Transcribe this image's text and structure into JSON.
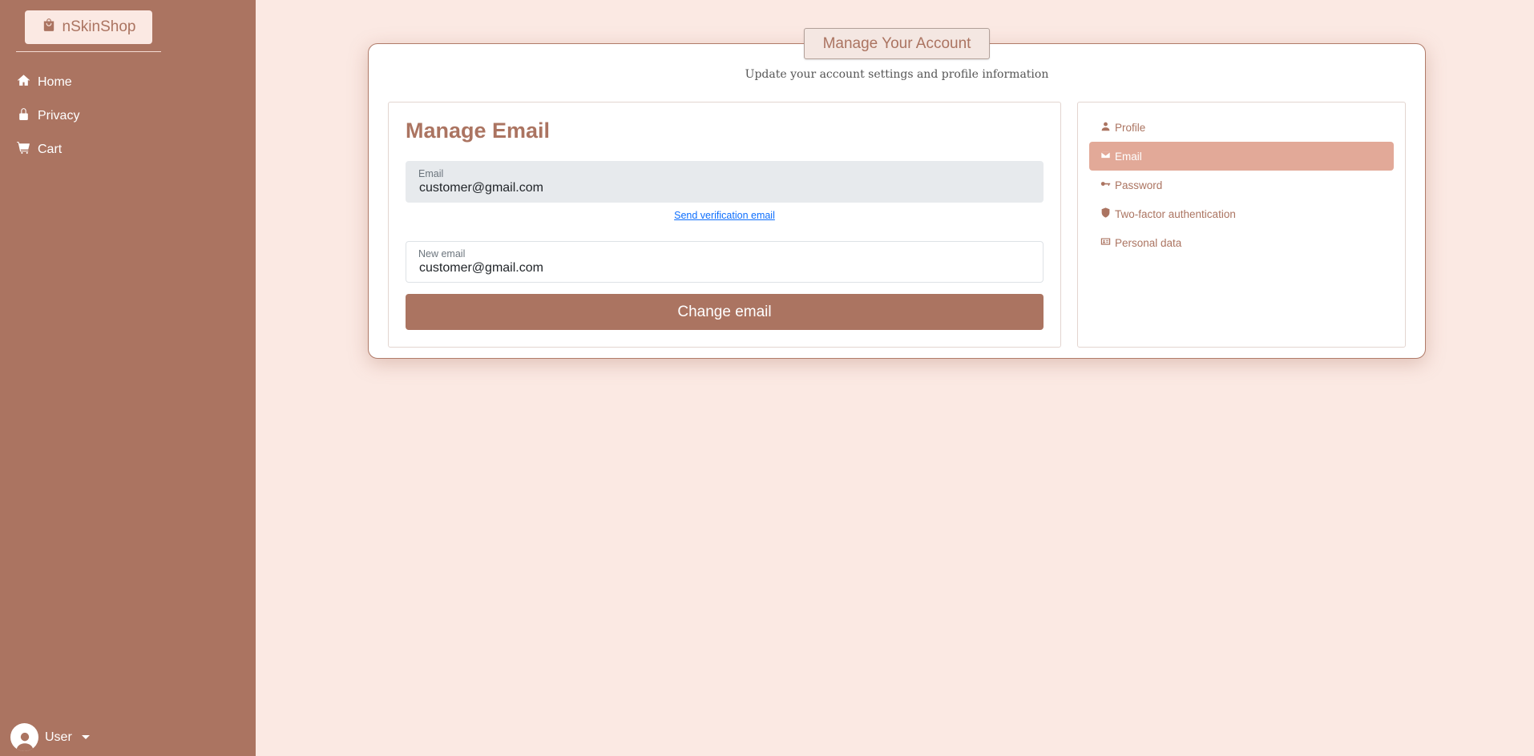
{
  "colors": {
    "sidebar": "#ab7461",
    "background": "#fbe9e3",
    "accent": "#ab7461",
    "active_nav": "#e2a998",
    "link": "#0d6efd"
  },
  "sidebar": {
    "brand": {
      "label": "nSkinShop",
      "icon": "shopping-bag-icon"
    },
    "items": [
      {
        "label": "Home",
        "icon": "home-icon"
      },
      {
        "label": "Privacy",
        "icon": "lock-icon"
      },
      {
        "label": "Cart",
        "icon": "cart-icon"
      }
    ],
    "user": {
      "label": "User",
      "icon": "user-avatar-icon"
    }
  },
  "card": {
    "title": "Manage Your Account",
    "subtitle": "Update your account settings and profile information"
  },
  "email_panel": {
    "title": "Manage Email",
    "email": {
      "label": "Email",
      "value": "customer@gmail.com"
    },
    "verify_link": "Send verification email",
    "new_email": {
      "label": "New email",
      "value": "customer@gmail.com"
    },
    "submit_label": "Change email"
  },
  "account_nav": {
    "active": "Email",
    "items": [
      {
        "label": "Profile",
        "icon": "person-icon"
      },
      {
        "label": "Email",
        "icon": "envelope-icon"
      },
      {
        "label": "Password",
        "icon": "key-icon"
      },
      {
        "label": "Two-factor authentication",
        "icon": "shield-icon"
      },
      {
        "label": "Personal data",
        "icon": "id-card-icon"
      }
    ]
  }
}
